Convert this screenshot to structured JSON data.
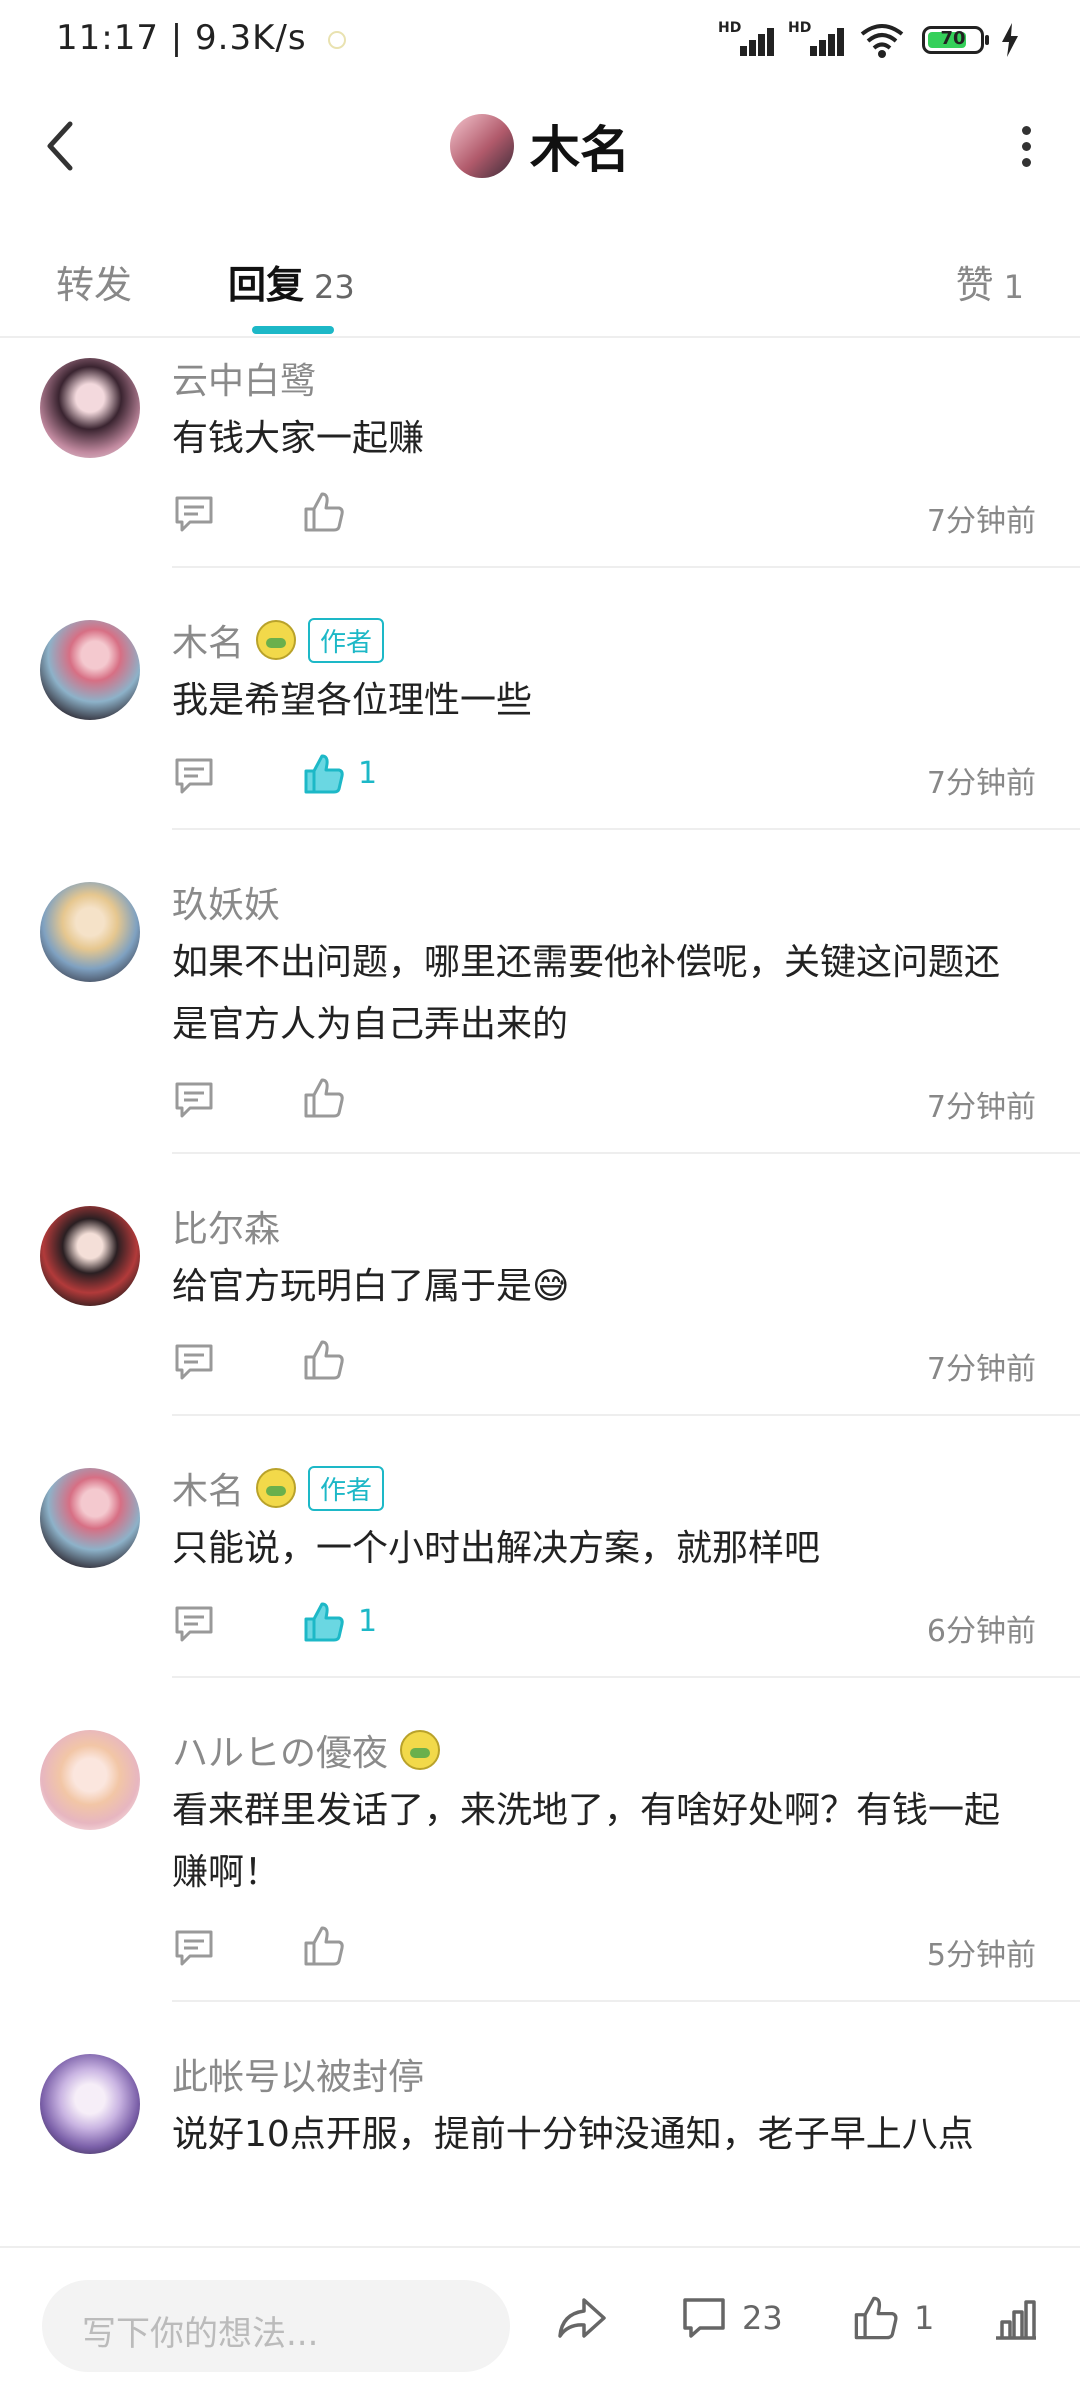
{
  "status": {
    "time_speed": "11:17 | 9.3K/s",
    "battery": "70"
  },
  "header": {
    "title": "木名"
  },
  "tabs": {
    "forward": "转发",
    "reply": "回复",
    "reply_count": "23",
    "like": "赞",
    "like_count": "1"
  },
  "comments": [
    {
      "name": "云中白鹭",
      "author": false,
      "badge": false,
      "text": "有钱大家一起赚",
      "liked": false,
      "likes": "",
      "time": "7分钟前"
    },
    {
      "name": "木名",
      "author": true,
      "badge": true,
      "text": "我是希望各位理性一些",
      "liked": true,
      "likes": "1",
      "time": "7分钟前"
    },
    {
      "name": "玖妖妖",
      "author": false,
      "badge": false,
      "text": "如果不出问题，哪里还需要他补偿呢，关键这问题还是官方人为自己弄出来的",
      "liked": false,
      "likes": "",
      "time": "7分钟前"
    },
    {
      "name": "比尔森",
      "author": false,
      "badge": false,
      "text": "给官方玩明白了属于是😅",
      "liked": false,
      "likes": "",
      "time": "7分钟前"
    },
    {
      "name": "木名",
      "author": true,
      "badge": true,
      "text": "只能说，一个小时出解决方案，就那样吧",
      "liked": true,
      "likes": "1",
      "time": "6分钟前"
    },
    {
      "name": "ハルヒの優夜",
      "author": false,
      "badge": true,
      "text": "看来群里发话了，来洗地了，有啥好处啊？有钱一起赚啊！",
      "liked": false,
      "likes": "",
      "time": "5分钟前"
    },
    {
      "name": "此帐号以被封停",
      "author": false,
      "badge": false,
      "text": "说好10点开服，提前十分钟没通知，老子早上八点",
      "liked": false,
      "likes": "",
      "time": ""
    }
  ],
  "author_tag": "作者",
  "bottom": {
    "placeholder": "写下你的想法...",
    "comment_count": "23",
    "like_count": "1"
  },
  "colors": {
    "accent": "#1db8c7"
  }
}
